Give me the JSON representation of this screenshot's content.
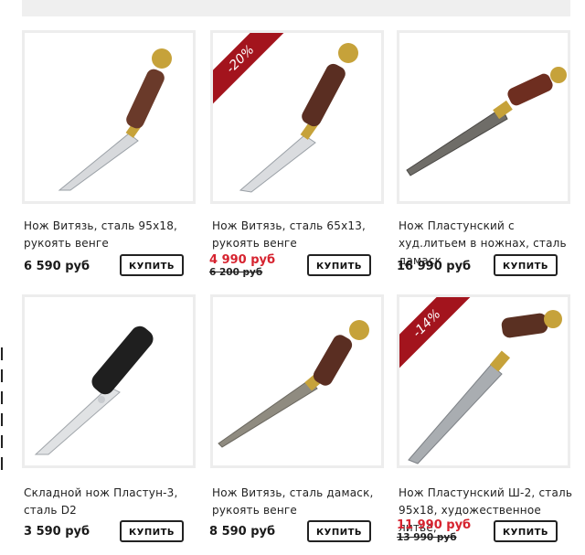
{
  "products": [
    {
      "title": "Нож Витязь, сталь 95х18, рукоять венге",
      "price": "6 590 руб",
      "old_price": "",
      "discount": "",
      "buy_label": "КУПИТЬ",
      "image_alt": "knife-birch-handle"
    },
    {
      "title": "Нож Витязь, сталь 65х13, рукоять венге",
      "price": "4 990 руб",
      "old_price": "6 200 руб",
      "discount": "-20%",
      "buy_label": "КУПИТЬ",
      "image_alt": "knife-ring-handle"
    },
    {
      "title": "Нож Пластунский с худ.литьем в ножнах, сталь дамаск",
      "price": "16 990 руб",
      "old_price": "",
      "discount": "",
      "buy_label": "КУПИТЬ",
      "image_alt": "damascus-knife"
    },
    {
      "title": "Складной нож Пластун-3, сталь D2",
      "price": "3 590 руб",
      "old_price": "",
      "discount": "",
      "buy_label": "КУПИТЬ",
      "image_alt": "folding-knife"
    },
    {
      "title": "Нож Витязь, сталь дамаск, рукоять венге",
      "price": "8 590 руб",
      "old_price": "",
      "discount": "",
      "buy_label": "КУПИТЬ",
      "image_alt": "damascus-vityaz-knife"
    },
    {
      "title": "Нож Пластунский Ш-2, сталь 95х18, художественное литье,",
      "price": "11 990 руб",
      "old_price": "13 990 руб",
      "discount": "-14%",
      "buy_label": "КУПИТЬ",
      "image_alt": "eagle-head-knife"
    }
  ],
  "colors": {
    "ribbon": "#a3141d",
    "sale_price": "#d6232f",
    "card_border": "#ededed"
  }
}
